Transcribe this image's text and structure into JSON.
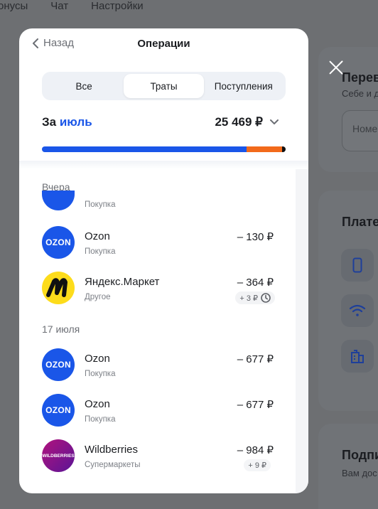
{
  "background": {
    "nav": [
      "онусы",
      "Чат",
      "Настройки"
    ],
    "card1": {
      "title": "Перев",
      "sub": "Себе и д",
      "input_placeholder": "Номе"
    },
    "card2": {
      "title": "Плате"
    },
    "card3": {
      "title": "Подпи",
      "sub": "Вам дос"
    },
    "tiles": [
      "phone-icon",
      "wifi-icon",
      "building-icon"
    ]
  },
  "modal": {
    "back_label": "Назад",
    "title": "Операции",
    "tabs": [
      "Все",
      "Траты",
      "Поступления"
    ],
    "active_tab": "Траты",
    "period_prefix": "За",
    "period_month": "июль",
    "total": "25 469 ₽",
    "spend_bar": {
      "segments": [
        {
          "share": 0.839,
          "color": "#1a56e8"
        },
        {
          "share": 0.146,
          "color": "#f26a1b"
        },
        {
          "share": 0.015,
          "color": "#111111"
        }
      ]
    },
    "groups": [
      {
        "label": "Вчера",
        "items": [
          {
            "logo": "ozon",
            "name": "",
            "category": "Покупка",
            "amount": ""
          },
          {
            "logo": "ozon",
            "name": "Ozon",
            "category": "Покупка",
            "amount": "– 130 ₽"
          },
          {
            "logo": "yandex-market",
            "name": "Яндекс.Маркет",
            "category": "Другое",
            "amount": "– 364 ₽",
            "cashback": "+ 3 ₽",
            "cashback_icon": "clock-icon"
          }
        ]
      },
      {
        "label": "17 июля",
        "items": [
          {
            "logo": "ozon",
            "name": "Ozon",
            "category": "Покупка",
            "amount": "– 677 ₽"
          },
          {
            "logo": "ozon",
            "name": "Ozon",
            "category": "Покупка",
            "amount": "– 677 ₽"
          },
          {
            "logo": "wildberries",
            "name": "Wildberries",
            "category": "Супермаркеты",
            "amount": "– 984 ₽",
            "cashback": "+ 9 ₽"
          }
        ]
      }
    ],
    "logo_texts": {
      "ozon": "OZON",
      "wildberries": "WILDBERRIES"
    }
  }
}
